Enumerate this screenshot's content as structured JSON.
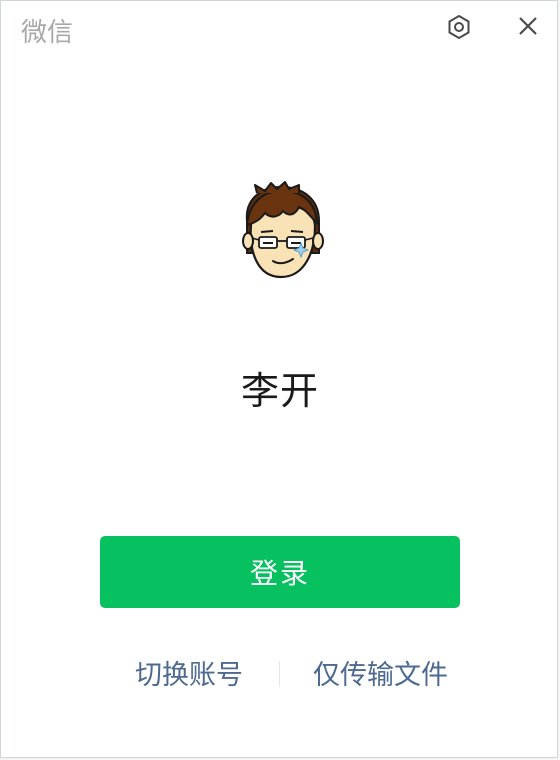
{
  "window": {
    "app_title": "微信"
  },
  "header": {
    "settings_icon": "hexagon-gear-icon",
    "close_icon": "close-icon"
  },
  "profile": {
    "avatar_icon": "cartoon-avatar",
    "name": "李开"
  },
  "actions": {
    "login_label": "登录",
    "switch_account_label": "切换账号",
    "file_transfer_only_label": "仅传输文件"
  },
  "colors": {
    "primary_green": "#07c160",
    "link_blue": "#4e6a90",
    "title_gray": "#a8a8a8",
    "background": "#ffffff"
  }
}
